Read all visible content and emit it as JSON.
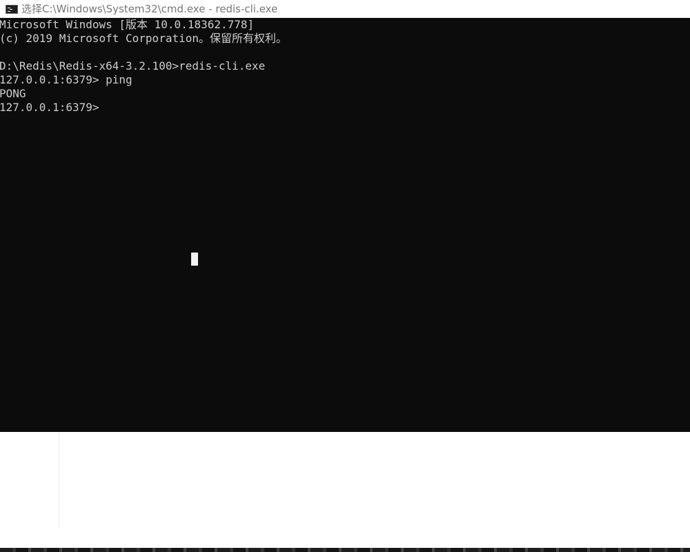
{
  "window": {
    "title": "选择C:\\Windows\\System32\\cmd.exe - redis-cli.exe",
    "icon": "cmd-icon"
  },
  "console": {
    "lines": [
      "Microsoft Windows [版本 10.0.18362.778]",
      "(c) 2019 Microsoft Corporation。保留所有权利。",
      "",
      "D:\\Redis\\Redis-x64-3.2.100>redis-cli.exe",
      "127.0.0.1:6379> ping",
      "PONG",
      "127.0.0.1:6379>"
    ],
    "background_color": "#0c0c0c",
    "text_color": "#cccccc",
    "cursor_color": "#f2f2f2"
  }
}
